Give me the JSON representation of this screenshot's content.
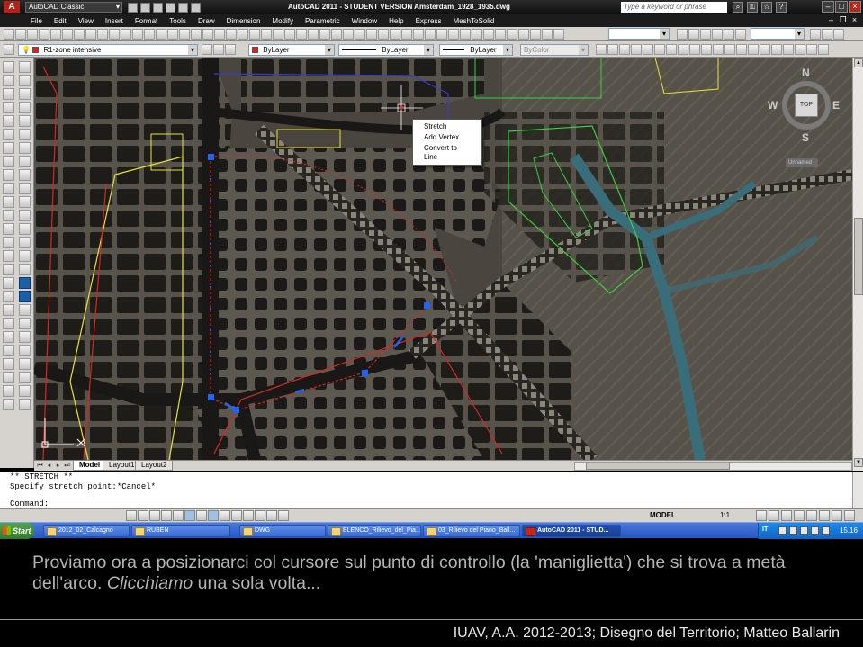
{
  "titlebar": {
    "workspace": "AutoCAD Classic",
    "title": "AutoCAD 2011 - STUDENT VERSION    Amsterdam_1928_1935.dwg",
    "search_placeholder": "Type a keyword or phrase",
    "logo_letter": "A"
  },
  "menu": {
    "items": [
      "File",
      "Edit",
      "View",
      "Insert",
      "Format",
      "Tools",
      "Draw",
      "Dimension",
      "Modify",
      "Parametric",
      "Window",
      "Help",
      "Express",
      "MeshToSolid"
    ]
  },
  "layers": {
    "current_layer": "R1-zone intensive",
    "color": "ByLayer",
    "linetype": "ByLayer",
    "lineweight": "ByLayer",
    "plotstyle": "ByColor",
    "layer_color": "#e0211b"
  },
  "context_menu": {
    "items": [
      "Stretch",
      "Add Vertex",
      "Convert to Line"
    ]
  },
  "viewcube": {
    "north": "N",
    "south": "S",
    "east": "E",
    "west": "W",
    "top": "TOP",
    "ucs": "Unnamed"
  },
  "layout_tabs": [
    "Model",
    "Layout1",
    "Layout2"
  ],
  "command": {
    "lines": [
      "** STRETCH **",
      "Specify stretch point:*Cancel*"
    ],
    "prompt": "Command:"
  },
  "statusbar": {
    "model": "MODEL",
    "scale": "1:1"
  },
  "taskbar": {
    "start": "Start",
    "tasks": [
      "2012_02_Calcagno",
      "RUBEN",
      "DWG",
      "ELENCO_Rilievo_del_Pia...",
      "03_Rilievo del Piano_Ball...",
      "AutoCAD 2011 - STUD..."
    ],
    "clock": "15.16",
    "lang": "IT"
  },
  "slide": {
    "caption_normal": "Proviamo ora a posizionarci col cursore sul punto di controllo (la 'maniglietta') che si trova a metà dell'arco. ",
    "caption_italic": "Clicchiamo",
    "caption_tail": " una sola volta...",
    "footer": "IUAV, A.A. 2012-2013; Disegno del Territorio; Matteo Ballarin"
  },
  "colors": {
    "grip": "#1e64ff",
    "zone_red": "#d42a22",
    "zone_green": "#3ecf3e",
    "zone_yellow": "#e6e23a",
    "zone_blue": "#3a3ad0"
  }
}
